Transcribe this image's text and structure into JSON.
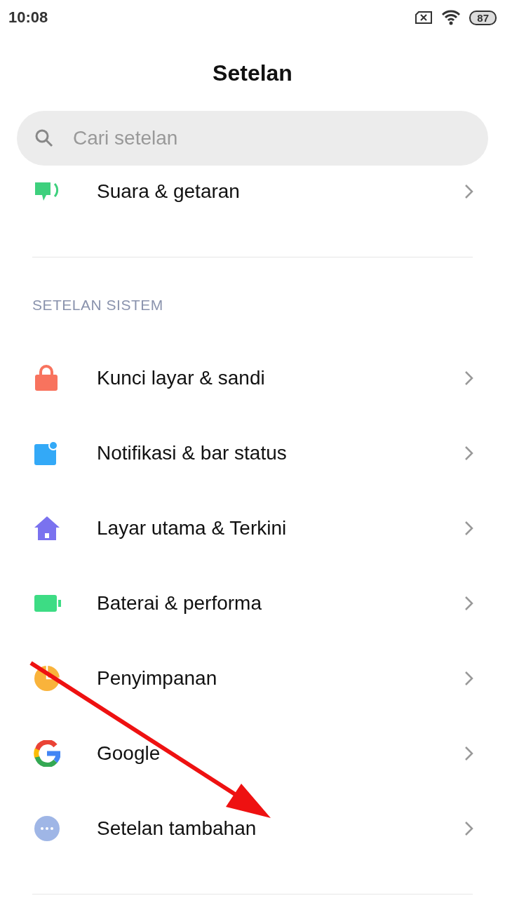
{
  "status_bar": {
    "time": "10:08",
    "battery": "87"
  },
  "title": "Setelan",
  "search": {
    "placeholder": "Cari setelan"
  },
  "top_items": [
    {
      "kind": "sound",
      "label": "Suara & getaran"
    }
  ],
  "section": {
    "header": "SETELAN SISTEM",
    "items": [
      {
        "kind": "lock",
        "label": "Kunci layar & sandi"
      },
      {
        "kind": "notification",
        "label": "Notifikasi & bar status"
      },
      {
        "kind": "home",
        "label": "Layar utama & Terkini"
      },
      {
        "kind": "battery",
        "label": "Baterai & performa"
      },
      {
        "kind": "storage",
        "label": "Penyimpanan"
      },
      {
        "kind": "google",
        "label": "Google"
      },
      {
        "kind": "more",
        "label": "Setelan tambahan"
      }
    ]
  }
}
